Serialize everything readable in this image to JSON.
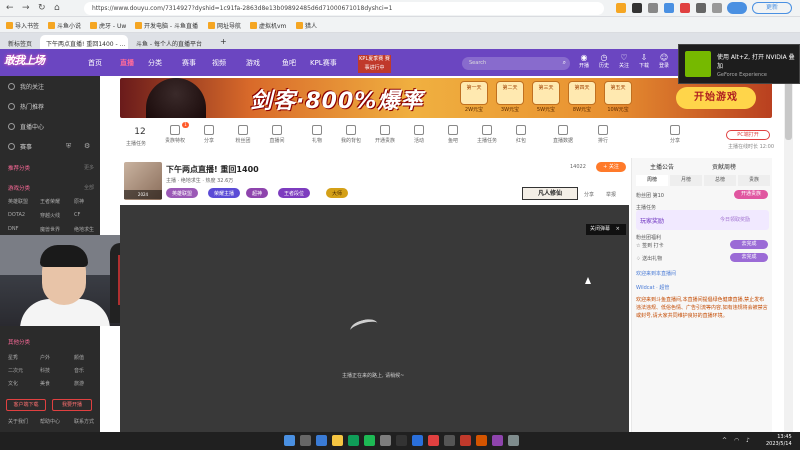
{
  "browser": {
    "url": "https://www.douyu.com/7314927?dyshid=1c91fa-2863d8e13b09892485d6d71000671018dyshci=1",
    "bookmarks": [
      "导入书签",
      "斗鱼小说",
      "虎牙 - Uw",
      "开发电脑 - 斗鱼直播",
      "网址导航",
      "虚拟机vm",
      "猎人"
    ],
    "tabs": [
      {
        "label": "新标签页"
      },
      {
        "label": "下午两点直播! 重回1400 - ..."
      },
      {
        "label": "斗鱼 - 每个人的直播平台"
      }
    ],
    "update_label": "更新"
  },
  "header": {
    "logo": "敢我上场",
    "nav": [
      "首页",
      "直播",
      "分类",
      "赛事",
      "视频",
      "游戏",
      "鱼吧",
      "KPL赛事"
    ],
    "kpl_badge": "KPL夏季赛 赛事进行中",
    "search_placeholder": "Search",
    "icons": [
      "开播",
      "历史",
      "关注",
      "下载",
      "登录"
    ]
  },
  "nvidia": {
    "title": "使用 Alt+Z, 打开 NVIDIA 叠加",
    "sub": "GeForce Experience"
  },
  "sidebar": {
    "top_items": [
      "我的关注",
      "热门推荐",
      "直播中心",
      "赛事"
    ],
    "section1_title": "推荐分类",
    "section1_more": "更多",
    "section2_title": "游戏分类",
    "section2_more": "全部",
    "games": [
      "英雄联盟",
      "DOTA2",
      "CF",
      "绝地求生",
      "王者荣耀",
      "穿越火线",
      "DNF",
      "魔兽世界",
      "原神"
    ],
    "section3_title": "其他分类",
    "others": [
      "星秀",
      "户外",
      "颜值",
      "二次元",
      "科技",
      "音乐",
      "文化",
      "美食",
      "旅游"
    ],
    "btn1": "客户端下载",
    "btn2": "我要开播",
    "footer": [
      "关于我们",
      "帮助中心",
      "联系方式"
    ]
  },
  "banner": {
    "headline": "剑客·800%爆率",
    "coins": [
      {
        "top": "第一天",
        "label": "2W元宝"
      },
      {
        "top": "第二天",
        "label": "3W元宝"
      },
      {
        "top": "第三天",
        "label": "5W元宝"
      },
      {
        "top": "第四天",
        "label": "8W元宝"
      },
      {
        "top": "第五天",
        "label": "10W元宝"
      }
    ],
    "cta": "开始游戏"
  },
  "toolbar": {
    "count": "12",
    "count_label": "主播任务",
    "items": [
      "贵族特权",
      "分享",
      "粉丝团",
      "直播间",
      "礼物",
      "我的背包",
      "开通贵族",
      "活动",
      "鱼吧",
      "主播任务",
      "红包",
      "直播数据",
      "排行",
      "分享"
    ],
    "badge": "1",
    "pc_btn": "PC端打开",
    "pc_sub": "主播在线时长 12:00"
  },
  "stream": {
    "title": "下午两点直播! 重回1400",
    "meta": "主播 · 绝地求生 · 热度 32.6万",
    "avatar_label": "2024",
    "tags": [
      "英雄联盟",
      "荣耀主播",
      "超神",
      "王者段位",
      "大师"
    ],
    "fans": "14022",
    "follow": "+ 关注",
    "brand": "凡人修仙",
    "share": "分享",
    "report": "举报"
  },
  "player": {
    "close_tag": "关闭弹幕",
    "loading_text": "主播正在来的路上, 请稍候~"
  },
  "right_panel": {
    "head_left": "主播公告",
    "head_right": "贡献周榜",
    "tabs": [
      "周榜",
      "月榜",
      "总榜",
      "贵族"
    ],
    "noble_label": "开通贵族",
    "fan_club": "粉丝团 第10",
    "rows": [
      "主播任务",
      "粉丝团福利"
    ],
    "card_title": "玩家奖励",
    "card_sub": "今日领取奖励",
    "task1": "签到 打卡",
    "task2": "送出礼物",
    "badge1": "去完成",
    "badge2": "去完成",
    "chat_user1": "欢迎来到本直播间",
    "chat_user2": "Wildcat · 超管",
    "system_msg": "欢迎来到斗鱼直播间,本直播间提倡绿色健康直播,禁止发布违法违规、低俗色情、广告引流等内容,如有违规将会被禁言或封号,请大家共同维护良好的直播环境。"
  },
  "taskbar": {
    "time": "13:45",
    "date": "2023/5/14"
  }
}
